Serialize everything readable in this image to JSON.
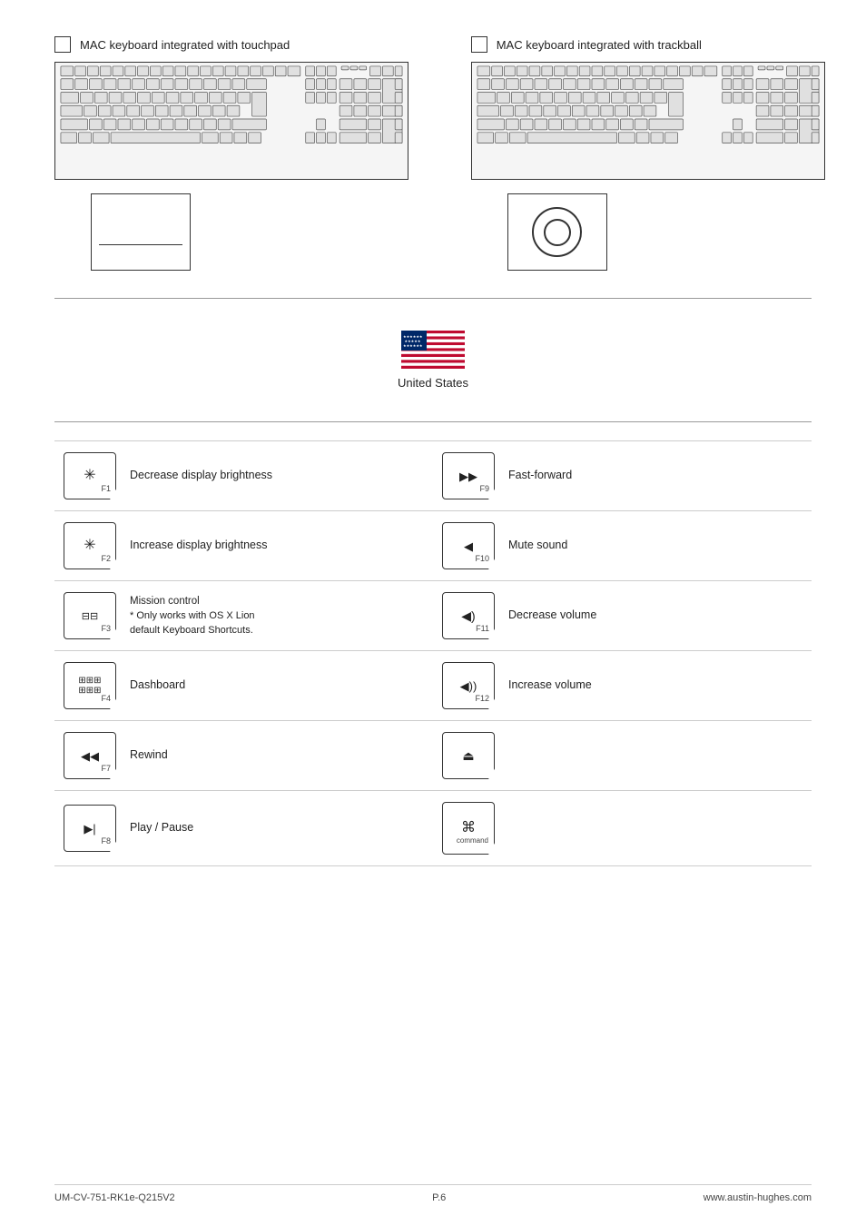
{
  "header": {
    "keyboard_touchpad_label": "MAC keyboard integrated with touchpad",
    "keyboard_trackball_label": "MAC keyboard integrated with trackball"
  },
  "flag": {
    "country": "United States"
  },
  "fkeys": [
    {
      "left": {
        "symbol": "✳",
        "label": "F1",
        "description": "Decrease display brightness"
      },
      "right": {
        "symbol": "▶▶",
        "label": "F9",
        "description": "Fast-forward"
      }
    },
    {
      "left": {
        "symbol": "✳",
        "label": "F2",
        "description": "Increase display brightness"
      },
      "right": {
        "symbol": "◀",
        "label": "F10",
        "description": "Mute sound"
      }
    },
    {
      "left": {
        "symbol": "⊞",
        "label": "F3",
        "description": "Mission control\n* Only works with OS X Lion\ndefault Keyboard Shortcuts."
      },
      "right": {
        "symbol": "◀)",
        "label": "F11",
        "description": "Decrease volume"
      }
    },
    {
      "left": {
        "symbol": "⊞⊞",
        "label": "F4",
        "description": "Dashboard"
      },
      "right": {
        "symbol": "◀))",
        "label": "F12",
        "description": "Increase volume"
      }
    },
    {
      "left": {
        "symbol": "◀◀",
        "label": "F7",
        "description": "Rewind"
      },
      "right": {
        "symbol": "▲",
        "label": "",
        "description": ""
      }
    },
    {
      "left": {
        "symbol": "▶|",
        "label": "F8",
        "description": "Play / Pause"
      },
      "right": {
        "symbol": "⌘",
        "label": "command",
        "description": ""
      }
    }
  ],
  "footer": {
    "model": "UM-CV-751-RK1e-Q215V2",
    "page": "P.6",
    "website": "www.austin-hughes.com"
  }
}
